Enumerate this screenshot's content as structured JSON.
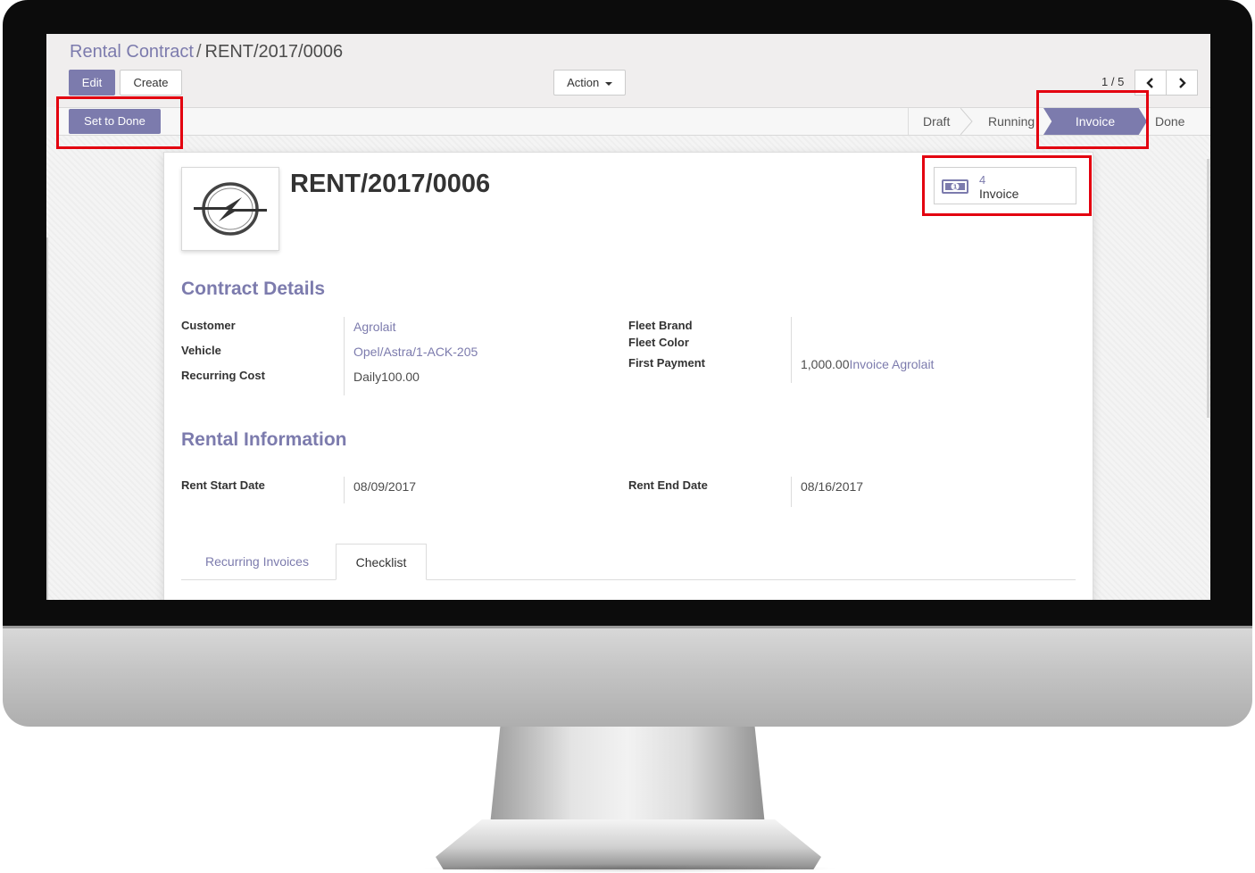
{
  "breadcrumb": {
    "parent": "Rental Contract",
    "separator": "/",
    "current": "RENT/2017/0006"
  },
  "toolbar": {
    "edit_label": "Edit",
    "create_label": "Create",
    "action_label": "Action"
  },
  "pager": {
    "value": "1 / 5"
  },
  "header_buttons": {
    "set_to_done_label": "Set to Done"
  },
  "statusbar": {
    "stages": [
      "Draft",
      "Running",
      "Invoice",
      "Done"
    ],
    "active": "Invoice"
  },
  "record": {
    "title": "RENT/2017/0006",
    "logo": "opel-logo"
  },
  "smart_button": {
    "count": "4",
    "label": "Invoice",
    "icon": "money-icon"
  },
  "contract_details": {
    "title": "Contract Details",
    "customer_label": "Customer",
    "customer_value": "Agrolait",
    "vehicle_label": "Vehicle",
    "vehicle_value": "Opel/Astra/1-ACK-205",
    "recurring_cost_label": "Recurring Cost",
    "recurring_cost_value": "Daily100.00",
    "fleet_brand_label": "Fleet Brand",
    "fleet_color_label": "Fleet Color",
    "first_payment_label": "First Payment",
    "first_payment_amount": "1,000.00",
    "first_payment_link": "Invoice Agrolait"
  },
  "rental_information": {
    "title": "Rental Information",
    "start_label": "Rent Start Date",
    "start_value": "08/09/2017",
    "end_label": "Rent End Date",
    "end_value": "08/16/2017"
  },
  "tabs": [
    {
      "label": "Recurring Invoices",
      "active": false
    },
    {
      "label": "Checklist",
      "active": true
    }
  ],
  "colors": {
    "brand": "#7c7bad",
    "highlight": "#e3000f"
  }
}
